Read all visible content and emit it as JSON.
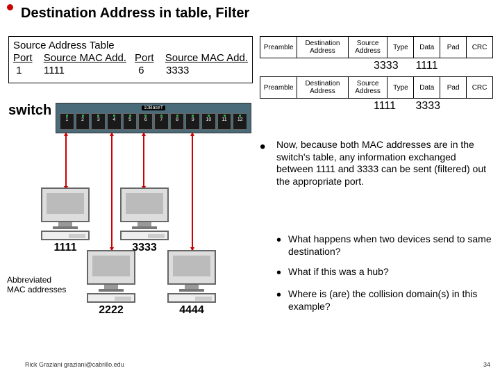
{
  "title": "Destination Address in table, Filter",
  "sat": {
    "heading": "Source Address Table",
    "cols": [
      "Port",
      "Source MAC Add.",
      "Port",
      "Source MAC Add."
    ],
    "row": [
      " 1",
      "1111",
      " 6",
      "3333"
    ]
  },
  "frame_headers": [
    "Preamble",
    "Destination Address",
    "Source Address",
    "Type",
    "Data",
    "Pad",
    "CRC"
  ],
  "frame1": {
    "da": "3333",
    "sa": "1111"
  },
  "frame2": {
    "da": "1111",
    "sa": "3333"
  },
  "switch_label": "switch",
  "tenbase": "10BaseT",
  "ports": [
    "1",
    "2",
    "3",
    "4",
    "5",
    "6",
    "7",
    "8",
    "9",
    "10",
    "11",
    "12"
  ],
  "pcs": {
    "p1": "1111",
    "p2": "2222",
    "p3": "3333",
    "p4": "4444"
  },
  "bullets": [
    "Now, because both MAC addresses are in the switch's table, any information exchanged between 1111 and 3333 can be sent (filtered) out the appropriate port.",
    "What happens when two devices send to same destination?",
    "What if this was a hub?",
    "Where is (are) the collision domain(s) in this example?"
  ],
  "abbr_note": "Abbreviated MAC addresses",
  "footer_left": "Rick Graziani  graziani@cabrillo.edu",
  "footer_right": "34"
}
